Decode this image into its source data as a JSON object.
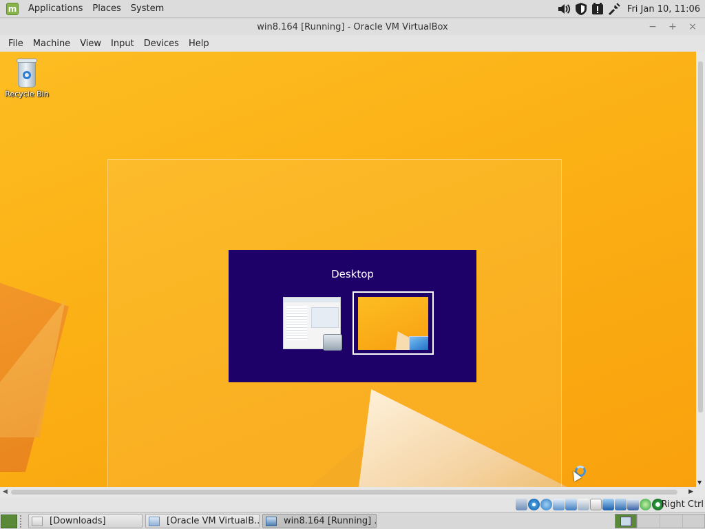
{
  "top_panel": {
    "menu_applications": "Applications",
    "menu_places": "Places",
    "menu_system": "System",
    "clock": "Fri Jan 10, 11:06",
    "tray_icons": [
      "volume-icon",
      "shield-icon",
      "update-manager-icon",
      "network-icon"
    ]
  },
  "window": {
    "title": "win8.164 [Running] - Oracle VM VirtualBox",
    "buttons": {
      "minimize": "−",
      "maximize": "+",
      "close": "×"
    }
  },
  "vbox_menu": [
    "File",
    "Machine",
    "View",
    "Input",
    "Devices",
    "Help"
  ],
  "guest": {
    "recycle_bin_label": "Recycle Bin",
    "switcher_label": "Desktop"
  },
  "vbox_status": {
    "host_key": "Right Ctrl",
    "icons": [
      "hard-disk-icon",
      "optical-drive-icon",
      "usb-icon",
      "shared-folders-icon",
      "display-icon",
      "video-capture-icon",
      "network-icon",
      "mouse-integration-icon",
      "keyboard-icon",
      "cpu-icon",
      "guest-additions-icon",
      "capture-icon"
    ]
  },
  "taskbar": {
    "tasks": [
      {
        "label": "[Downloads]",
        "icon": "folder-icon",
        "active": false
      },
      {
        "label": "[Oracle VM VirtualB...",
        "icon": "virtualbox-icon",
        "active": false
      },
      {
        "label": "win8.164 [Running] ...",
        "icon": "virtualbox-vm-icon",
        "active": true
      }
    ]
  },
  "colors": {
    "wallpaper": "#fbb014",
    "switcher_bg": "#1e0069",
    "mint_green": "#87b34a"
  }
}
